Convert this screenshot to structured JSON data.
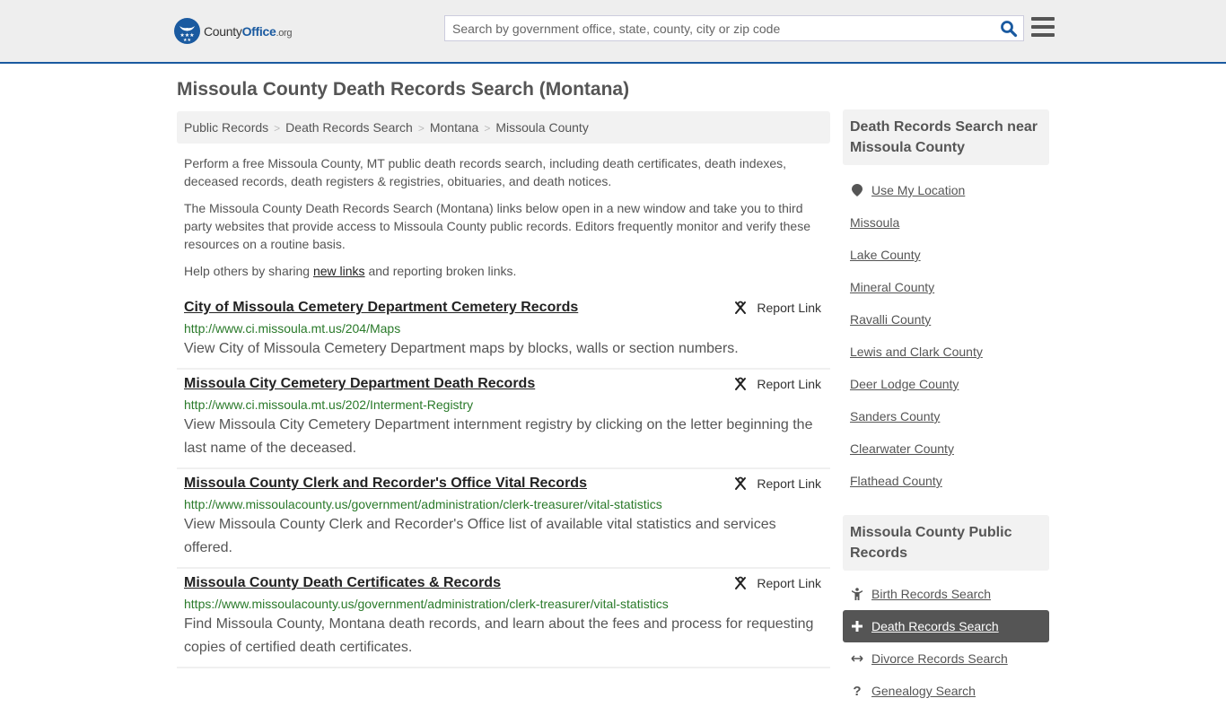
{
  "header": {
    "logo": {
      "county": "County",
      "office": "Office",
      "org": ".org"
    },
    "search_placeholder": "Search by government office, state, county, city or zip code",
    "search_value": ""
  },
  "page_title": "Missoula County Death Records Search (Montana)",
  "breadcrumb": [
    {
      "label": "Public Records"
    },
    {
      "label": "Death Records Search"
    },
    {
      "label": "Montana"
    },
    {
      "label": "Missoula County"
    }
  ],
  "breadcrumb_separator": ">",
  "intro": {
    "p1": "Perform a free Missoula County, MT public death records search, including death certificates, death indexes, deceased records, death registers & registries, obituaries, and death notices.",
    "p2": "The Missoula County Death Records Search (Montana) links below open in a new window and take you to third party websites that provide access to Missoula County public records. Editors frequently monitor and verify these resources on a routine basis.",
    "p3_before": "Help others by sharing ",
    "p3_link": "new links",
    "p3_after": " and reporting broken links."
  },
  "report_label": "Report Link",
  "results": [
    {
      "title": "City of Missoula Cemetery Department Cemetery Records",
      "url": "http://www.ci.missoula.mt.us/204/Maps",
      "description": "View City of Missoula Cemetery Department maps by blocks, walls or section numbers."
    },
    {
      "title": "Missoula City Cemetery Department Death Records",
      "url": "http://www.ci.missoula.mt.us/202/Interment-Registry",
      "description": "View Missoula City Cemetery Department internment registry by clicking on the letter beginning the last name of the deceased."
    },
    {
      "title": "Missoula County Clerk and Recorder's Office Vital Records",
      "url": "http://www.missoulacounty.us/government/administration/clerk-treasurer/vital-statistics",
      "description": "View Missoula County Clerk and Recorder's Office list of available vital statistics and services offered."
    },
    {
      "title": "Missoula County Death Certificates & Records",
      "url": "https://www.missoulacounty.us/government/administration/clerk-treasurer/vital-statistics",
      "description": "Find Missoula County, Montana death records, and learn about the fees and process for requesting copies of certified death certificates."
    }
  ],
  "sidebar": {
    "nearby_heading": "Death Records Search near Missoula County",
    "use_location": "Use My Location",
    "nearby": [
      "Missoula",
      "Lake County",
      "Mineral County",
      "Ravalli County",
      "Lewis and Clark County",
      "Deer Lodge County",
      "Sanders County",
      "Clearwater County",
      "Flathead County"
    ],
    "public_records_heading": "Missoula County Public Records",
    "public_records": [
      {
        "label": "Birth Records Search",
        "icon": "child-icon",
        "active": false
      },
      {
        "label": "Death Records Search",
        "icon": "plus-icon",
        "active": true
      },
      {
        "label": "Divorce Records Search",
        "icon": "arrows-horizontal-icon",
        "active": false
      },
      {
        "label": "Genealogy Search",
        "icon": "question-icon",
        "active": false
      }
    ]
  },
  "colors": {
    "brand_blue": "#1a5aa0",
    "url_green": "#2a7a2a",
    "active_bg": "#555555"
  }
}
